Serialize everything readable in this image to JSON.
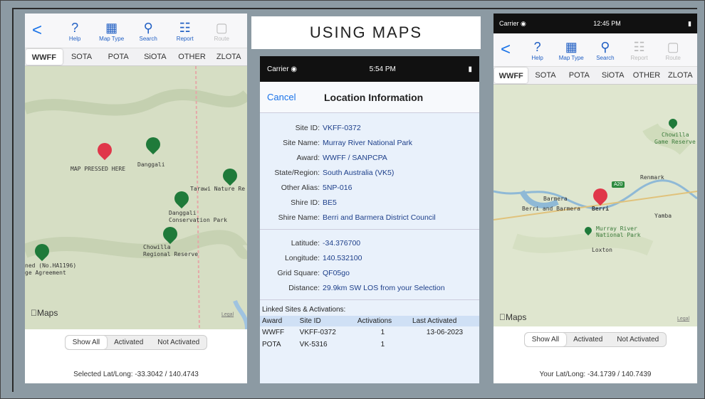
{
  "slide_title": "USING MAPS",
  "phone1": {
    "toolbar": {
      "back": "<",
      "items": [
        {
          "label": "Help",
          "icon": "help-icon",
          "glyph": "?"
        },
        {
          "label": "Map Type",
          "icon": "map-icon",
          "glyph": "▦"
        },
        {
          "label": "Search",
          "icon": "search-icon",
          "glyph": "⚲"
        },
        {
          "label": "Report",
          "icon": "report-icon",
          "glyph": "☷"
        },
        {
          "label": "Route",
          "icon": "route-icon",
          "glyph": "▢"
        }
      ]
    },
    "tabs": [
      "WWFF",
      "SOTA",
      "POTA",
      "SiOTA",
      "OTHER",
      "ZLOTA"
    ],
    "map_labels": [
      "MAP PRESSED HERE",
      "Danggali",
      "Tarawi Nature Re",
      "Danggali",
      "Conservation Park",
      "Chowilla",
      "Regional Reserve",
      "ned (No.HA1196)",
      "ge Agreement"
    ],
    "maps_brand": "Maps",
    "legal": "Legal",
    "segments": [
      "Show All",
      "Activated",
      "Not Activated"
    ],
    "latlong": "Selected Lat/Long: -33.3042 / 140.4743"
  },
  "phone2": {
    "status": {
      "carrier": "Carrier ◉",
      "time": "5:54 PM",
      "battery": "▮"
    },
    "cancel": "Cancel",
    "title": "Location Information",
    "fields": [
      {
        "k": "Site ID:",
        "v": "VKFF-0372"
      },
      {
        "k": "Site Name:",
        "v": "Murray River National Park"
      },
      {
        "k": "Award:",
        "v": "WWFF / SANPCPA"
      },
      {
        "k": "State/Region:",
        "v": "South Australia (VK5)"
      },
      {
        "k": "Other Alias:",
        "v": "5NP-016"
      },
      {
        "k": "Shire ID:",
        "v": "BE5"
      },
      {
        "k": "Shire Name:",
        "v": "Berri and Barmera District Council"
      }
    ],
    "fields2": [
      {
        "k": "Latitude:",
        "v": "-34.376700"
      },
      {
        "k": "Longitude:",
        "v": "140.532100"
      },
      {
        "k": "Grid Square:",
        "v": "QF05go"
      },
      {
        "k": "Distance:",
        "v": "29.9km SW LOS from your Selection"
      }
    ],
    "linked_title": "Linked Sites & Activations:",
    "table_headers": [
      "Award",
      "Site ID",
      "Activations",
      "Last Activated"
    ],
    "table_rows": [
      [
        "WWFF",
        "VKFF-0372",
        "1",
        "13-06-2023"
      ],
      [
        "POTA",
        "VK-5316",
        "1",
        ""
      ]
    ]
  },
  "phone3": {
    "status": {
      "carrier": "Carrier ◉",
      "time": "12:45 PM",
      "battery": "▮"
    },
    "toolbar": {
      "back": "<",
      "items": [
        {
          "label": "Help",
          "icon": "help-icon",
          "glyph": "?"
        },
        {
          "label": "Map Type",
          "icon": "map-icon",
          "glyph": "▦"
        },
        {
          "label": "Search",
          "icon": "search-icon",
          "glyph": "⚲"
        },
        {
          "label": "Report",
          "icon": "report-icon",
          "glyph": "☷"
        },
        {
          "label": "Route",
          "icon": "route-icon",
          "glyph": "▢"
        }
      ]
    },
    "tabs": [
      "WWFF",
      "SOTA",
      "POTA",
      "SiOTA",
      "OTHER",
      "ZLOTA"
    ],
    "map_labels": [
      "Chowilla",
      "Game Reserve",
      "Renmark",
      "Barmera",
      "Berri and Barmera",
      "Berri",
      "Yamba",
      "Murray River",
      "National Park",
      "Loxton",
      "A20"
    ],
    "maps_brand": "Maps",
    "legal": "Legal",
    "segments": [
      "Show All",
      "Activated",
      "Not Activated"
    ],
    "latlong": "Your Lat/Long: -34.1739 / 140.7439"
  }
}
